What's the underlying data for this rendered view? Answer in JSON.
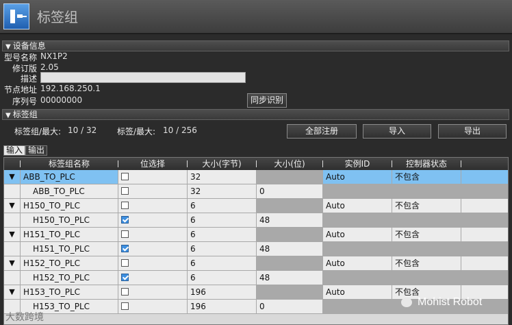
{
  "app": {
    "title": "标签组"
  },
  "device_info": {
    "section_title": "设备信息",
    "model_label": "型号名称",
    "model_value": "NX1P2",
    "revision_label": "修订版",
    "revision_value": "2.05",
    "desc_label": "描述",
    "desc_value": "",
    "node_label": "节点地址",
    "node_value": "192.168.250.1",
    "serial_label": "序列号",
    "serial_value": "00000000",
    "sync_button": "同步识别"
  },
  "tag_group": {
    "section_title": "标签组",
    "groups_label": "标签组/最大:",
    "groups_value": "10  /  32",
    "tags_label": "标签/最大:",
    "tags_value": "10  /  256",
    "register_all_button": "全部注册",
    "import_button": "导入",
    "export_button": "导出"
  },
  "tabs": [
    {
      "label": "输入",
      "active": true
    },
    {
      "label": "输出",
      "active": false
    }
  ],
  "table": {
    "headers": [
      "标签组名称",
      "位选择",
      "大小(字节)",
      "大小(位)",
      "实例ID",
      "控制器状态"
    ],
    "rows": [
      {
        "expand": "▼",
        "name": "ABB_TO_PLC",
        "checked": false,
        "size_bytes": "32",
        "size_bits": "",
        "instance_id": "Auto",
        "status": "不包含",
        "kind": "group",
        "selected": true
      },
      {
        "expand": "",
        "name": "ABB_TO_PLC",
        "checked": false,
        "size_bytes": "32",
        "size_bits": "0",
        "instance_id": "",
        "status": "",
        "kind": "child"
      },
      {
        "expand": "▼",
        "name": "H150_TO_PLC",
        "checked": false,
        "size_bytes": "6",
        "size_bits": "",
        "instance_id": "Auto",
        "status": "不包含",
        "kind": "group"
      },
      {
        "expand": "",
        "name": "H150_TO_PLC",
        "checked": true,
        "size_bytes": "6",
        "size_bits": "48",
        "instance_id": "",
        "status": "",
        "kind": "child"
      },
      {
        "expand": "▼",
        "name": "H151_TO_PLC",
        "checked": false,
        "size_bytes": "6",
        "size_bits": "",
        "instance_id": "Auto",
        "status": "不包含",
        "kind": "group"
      },
      {
        "expand": "",
        "name": "H151_TO_PLC",
        "checked": true,
        "size_bytes": "6",
        "size_bits": "48",
        "instance_id": "",
        "status": "",
        "kind": "child"
      },
      {
        "expand": "▼",
        "name": "H152_TO_PLC",
        "checked": false,
        "size_bytes": "6",
        "size_bits": "",
        "instance_id": "Auto",
        "status": "不包含",
        "kind": "group"
      },
      {
        "expand": "",
        "name": "H152_TO_PLC",
        "checked": true,
        "size_bytes": "6",
        "size_bits": "48",
        "instance_id": "",
        "status": "",
        "kind": "child"
      },
      {
        "expand": "▼",
        "name": "H153_TO_PLC",
        "checked": false,
        "size_bytes": "196",
        "size_bits": "",
        "instance_id": "Auto",
        "status": "不包含",
        "kind": "group"
      },
      {
        "expand": "",
        "name": "H153_TO_PLC",
        "checked": false,
        "size_bytes": "196",
        "size_bits": "0",
        "instance_id": "",
        "status": "",
        "kind": "child"
      }
    ]
  },
  "watermark": {
    "text": "Mohist Robot",
    "left_text": "大数跨境"
  }
}
